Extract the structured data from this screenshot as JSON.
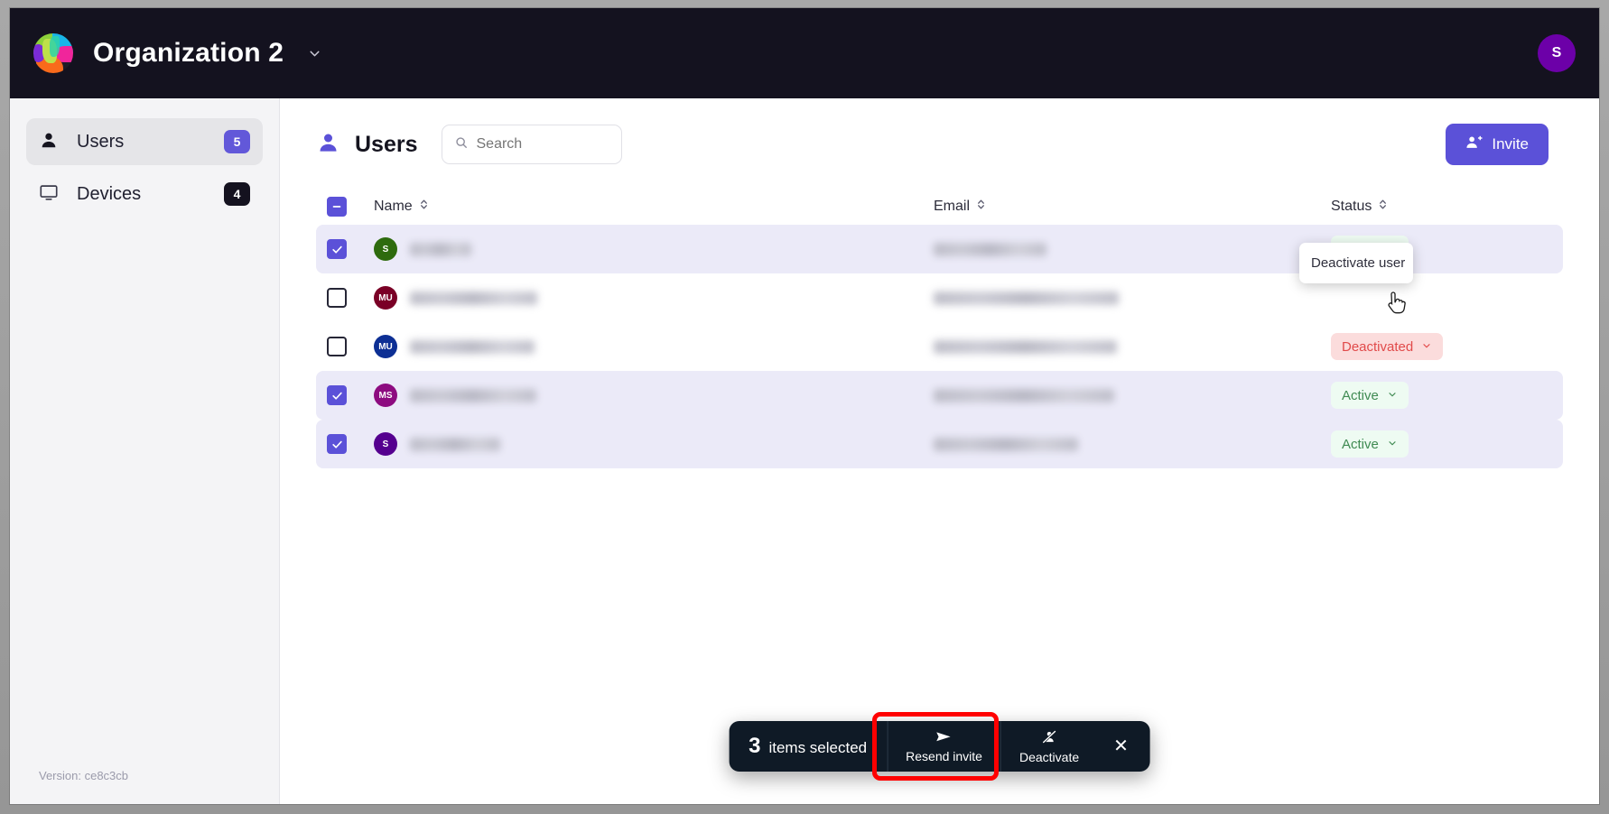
{
  "topbar": {
    "logo_icon": "colorful-sphere-logo",
    "org_title": "Organization 2",
    "org_caret_icon": "chevron-down-icon",
    "user_avatar_initial": "S",
    "user_avatar_color": "#6c00a8",
    "background_color": "#14121f"
  },
  "sidebar": {
    "items": [
      {
        "label": "Users",
        "badge": "5",
        "icon": "person-icon",
        "active": true,
        "badge_color": "#6258d9"
      },
      {
        "label": "Devices",
        "badge": "4",
        "icon": "monitor-icon",
        "active": false,
        "badge_color": "#14121f"
      }
    ],
    "version_text": "Version: ce8c3cb"
  },
  "main": {
    "page_icon": "person-icon",
    "page_title": "Users",
    "search": {
      "placeholder": "Search",
      "value": "",
      "icon": "search-icon"
    },
    "invite_button": {
      "label": "Invite",
      "icon": "person-plus-icon",
      "color": "#5b51d8"
    }
  },
  "table": {
    "select_all_state": "indeterminate",
    "columns": [
      {
        "key": "name",
        "label": "Name",
        "sort_icon": "sort-chevrons-icon"
      },
      {
        "key": "email",
        "label": "Email",
        "sort_icon": "sort-chevrons-icon"
      },
      {
        "key": "status",
        "label": "Status",
        "sort_icon": "sort-chevrons-icon"
      }
    ],
    "rows": [
      {
        "selected": true,
        "avatar_initials": "S",
        "avatar_color": "#2e6b0e",
        "name": "",
        "email": "",
        "status": "Active",
        "name_width": 68,
        "email_width": 125,
        "status_style": "active-s"
      },
      {
        "selected": false,
        "avatar_initials": "MU",
        "avatar_color": "#7a0026",
        "name": "",
        "email": "",
        "status": "",
        "name_width": 141,
        "email_width": 205,
        "status_style": "none"
      },
      {
        "selected": false,
        "avatar_initials": "MU",
        "avatar_color": "#0d2f94",
        "name": "",
        "email": "",
        "status": "Deactivated",
        "name_width": 138,
        "email_width": 203,
        "status_style": "deact-s"
      },
      {
        "selected": true,
        "avatar_initials": "MS",
        "avatar_color": "#8d0b80",
        "name": "",
        "email": "",
        "status": "Active",
        "name_width": 140,
        "email_width": 200,
        "status_style": "active-s"
      },
      {
        "selected": true,
        "avatar_initials": "S",
        "avatar_color": "#55008f",
        "name": "",
        "email": "",
        "status": "Active",
        "name_width": 100,
        "email_width": 160,
        "status_style": "active-s"
      }
    ],
    "status_dropdown": {
      "visible": true,
      "items": [
        {
          "label": "Deactivate user"
        }
      ]
    }
  },
  "bulk_toolbar": {
    "count": "3",
    "count_label": "items selected",
    "actions": [
      {
        "label": "Resend invite",
        "icon": "send-icon",
        "highlighted": true
      },
      {
        "label": "Deactivate",
        "icon": "person-slash-icon",
        "highlighted": false
      }
    ],
    "close_icon": "close-icon",
    "background_color": "#0f1a26"
  },
  "annotation": {
    "box_color": "#ff0000",
    "target": "Resend invite"
  }
}
